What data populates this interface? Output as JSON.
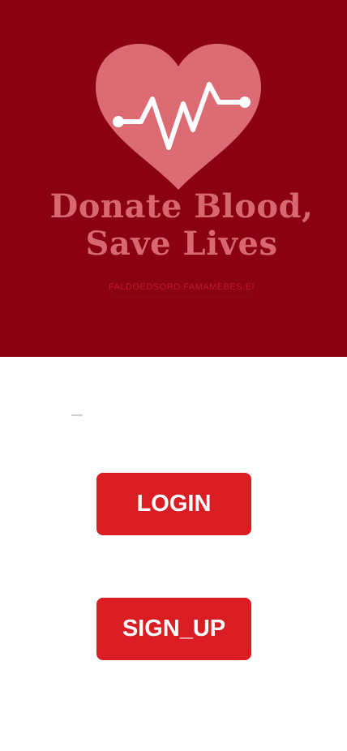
{
  "hero": {
    "title_line1": "Donate Blood,",
    "title_line2": "Save Lives",
    "url_text": "FALDOEDSORD.FAMAMEBES.EI",
    "heart_icon": "heart-pulse-icon"
  },
  "buttons": {
    "login_label": "LOGIN",
    "signup_label": "SIGN_UP"
  },
  "colors": {
    "hero_bg": "#8a0212",
    "heart": "#dc6b74",
    "button": "#d91d22"
  }
}
